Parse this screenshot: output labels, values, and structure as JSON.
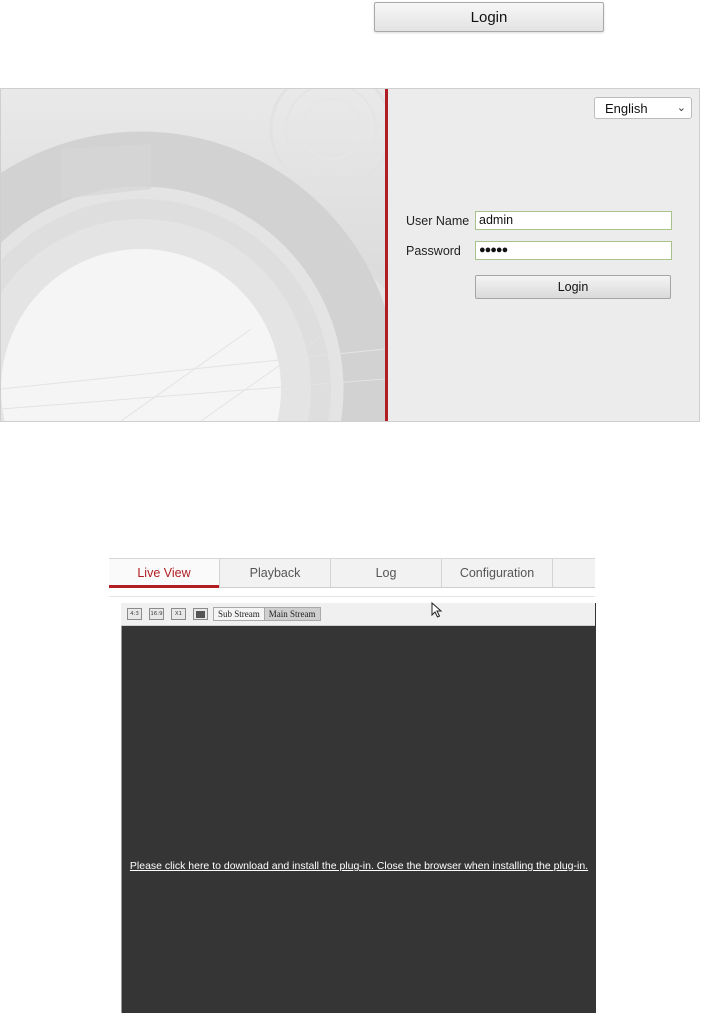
{
  "top_login": {
    "label": "Login"
  },
  "login_form": {
    "language": "English",
    "username_label": "User Name",
    "username_value": "admin",
    "password_label": "Password",
    "password_value": "●●●●●",
    "login_label": "Login"
  },
  "client": {
    "tabs": [
      {
        "label": "Live View",
        "active": true
      },
      {
        "label": "Playback"
      },
      {
        "label": "Log"
      },
      {
        "label": "Configuration"
      }
    ],
    "toolbar": {
      "icons": [
        "4:3",
        "16:9",
        "X1",
        "■"
      ],
      "sub_stream": "Sub Stream",
      "main_stream": "Main Stream"
    },
    "plugin_message": "Please click here to download and install the plug-in. Close the browser when installing the plug-in."
  },
  "colors": {
    "accent": "#b01e23",
    "viewer_bg": "#353535"
  }
}
